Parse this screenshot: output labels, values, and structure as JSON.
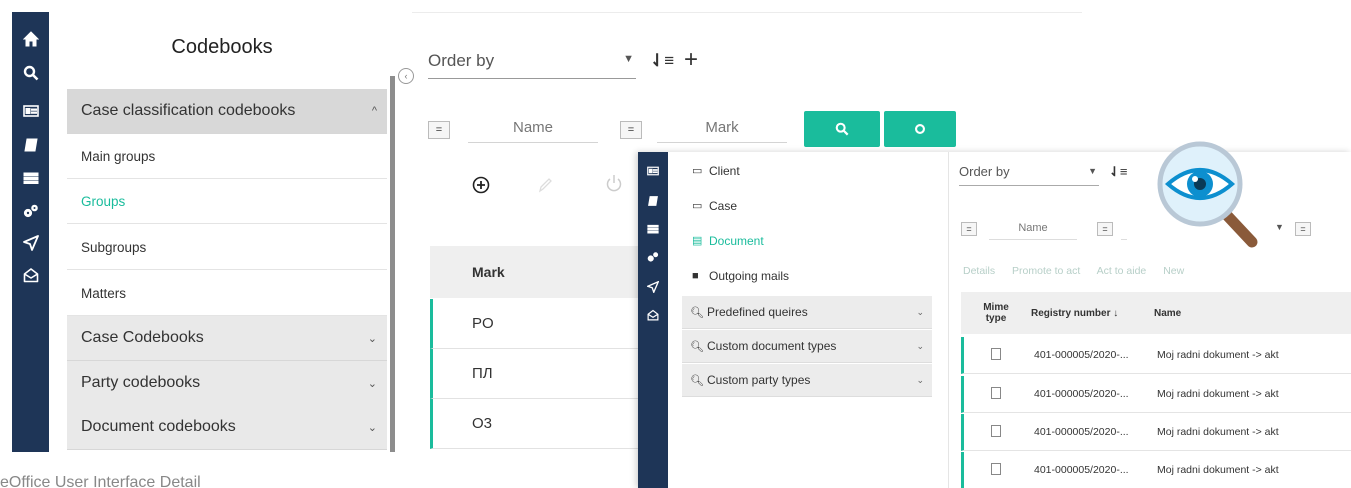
{
  "rail": {
    "icons": [
      "home-icon",
      "search-icon",
      "id-card-icon",
      "book-icon",
      "list-icon",
      "cogs-icon",
      "send-icon",
      "envelope-open-icon"
    ]
  },
  "codebooks": {
    "title": "Codebooks",
    "items": [
      {
        "label": "Case classification codebooks",
        "type": "group",
        "expanded": true
      },
      {
        "label": "Main groups",
        "type": "sub"
      },
      {
        "label": "Groups",
        "type": "sub",
        "active": true
      },
      {
        "label": "Subgroups",
        "type": "sub"
      },
      {
        "label": "Matters",
        "type": "sub"
      },
      {
        "label": "Case Codebooks",
        "type": "group"
      },
      {
        "label": "Party codebooks",
        "type": "group"
      },
      {
        "label": "Document codebooks",
        "type": "group"
      }
    ]
  },
  "main": {
    "order_by": "Order by",
    "filter_eq": "=",
    "filter_name": "Name",
    "filter_mark": "Mark",
    "table": {
      "header": "Mark",
      "rows": [
        "PO",
        "ПЛ",
        "O3"
      ]
    }
  },
  "overlay": {
    "menu": [
      {
        "label": "Client",
        "glyph": "▭"
      },
      {
        "label": "Case",
        "glyph": "▭"
      },
      {
        "label": "Document",
        "glyph": "▤",
        "active": true
      },
      {
        "label": "Outgoing mails",
        "glyph": "■"
      },
      {
        "label": "Predefined queires",
        "group": true
      },
      {
        "label": "Custom document types",
        "group": true
      },
      {
        "label": "Custom party types",
        "group": true
      }
    ],
    "order_by": "Order by",
    "filter_name": "Name",
    "actions": [
      "Details",
      "Promote to act",
      "Act to aide",
      "New"
    ],
    "columns": {
      "mime": "Mime type",
      "registry": "Registry number ↓",
      "name": "Name"
    },
    "rows": [
      {
        "registry": "401-000005/2020-...",
        "name": "Moj radni dokument -> akt"
      },
      {
        "registry": "401-000005/2020-...",
        "name": "Moj radni dokument -> akt"
      },
      {
        "registry": "401-000005/2020-...",
        "name": "Moj radni dokument -> akt"
      },
      {
        "registry": "401-000005/2020-...",
        "name": "Moj radni dokument -> akt"
      }
    ]
  },
  "caption": "eOffice User Interface Detail",
  "colors": {
    "accent": "#1abc9c",
    "rail": "#1e3557"
  }
}
